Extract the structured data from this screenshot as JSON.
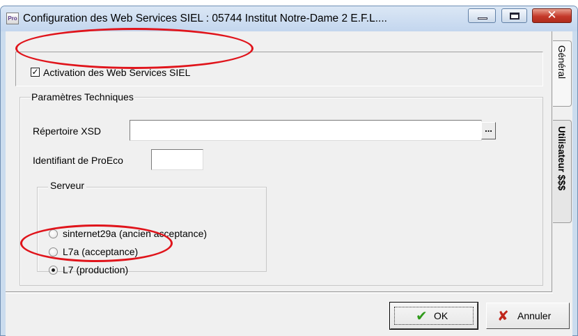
{
  "window": {
    "title": "Configuration des Web Services SIEL : 05744 Institut Notre-Dame 2 E.F.L....",
    "app_icon": "Pro",
    "controls": {
      "minimize": "minimize",
      "maximize": "maximize",
      "close": "✕"
    }
  },
  "activation": {
    "label": "Activation des Web Services SIEL",
    "checked": true,
    "check_mark": "✓"
  },
  "technical": {
    "legend": "Paramètres Techniques",
    "xsd_label": "Répertoire XSD",
    "xsd_value": "",
    "browse_label": "...",
    "proeco_label": "Identifiant de ProEco",
    "proeco_value": ""
  },
  "server": {
    "legend": "Serveur",
    "options": [
      {
        "label": "sinternet29a (ancien acceptance)",
        "selected": false
      },
      {
        "label": "L7a (acceptance)",
        "selected": false
      },
      {
        "label": "L7 (production)",
        "selected": true
      }
    ]
  },
  "tabs": [
    {
      "label": "Général",
      "active": true
    },
    {
      "label": "Utilisateur $$$",
      "active": false
    }
  ],
  "buttons": {
    "ok_label": "OK",
    "ok_icon": "✔",
    "cancel_label": "Annuler",
    "cancel_icon": "✘"
  },
  "annotations": {
    "color": "#e0141b"
  },
  "colors": {
    "title_bar": "#c3d6ee",
    "dialog_bg": "#f0f0f0",
    "close_button": "#c4392a"
  }
}
